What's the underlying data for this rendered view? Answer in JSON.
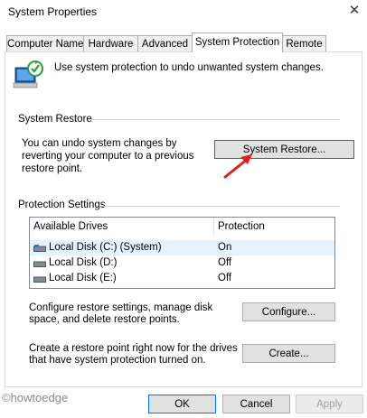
{
  "window": {
    "title": "System Properties"
  },
  "tabs": [
    {
      "label": "Computer Name"
    },
    {
      "label": "Hardware"
    },
    {
      "label": "Advanced"
    },
    {
      "label": "System Protection"
    },
    {
      "label": "Remote"
    }
  ],
  "intro": {
    "text": "Use system protection to undo unwanted system changes."
  },
  "system_restore": {
    "heading": "System Restore",
    "description": "You can undo system changes by reverting your computer to a previous restore point.",
    "button_label": "System Restore..."
  },
  "protection_settings": {
    "heading": "Protection Settings",
    "columns": [
      "Available Drives",
      "Protection"
    ],
    "rows": [
      {
        "drive": "Local Disk (C:) (System)",
        "protection": "On"
      },
      {
        "drive": "Local Disk (D:)",
        "protection": "Off"
      },
      {
        "drive": "Local Disk (E:)",
        "protection": "Off"
      }
    ],
    "configure_text": "Configure restore settings, manage disk space, and delete restore points.",
    "configure_label": "Configure...",
    "create_text": "Create a restore point right now for the drives that have system protection turned on.",
    "create_label": "Create..."
  },
  "footer": {
    "watermark": "©howtoedge",
    "ok_label": "OK",
    "cancel_label": "Cancel",
    "apply_label": "Apply"
  },
  "colors": {
    "annotation_arrow": "#e02020",
    "focus_border": "#0078d7"
  }
}
